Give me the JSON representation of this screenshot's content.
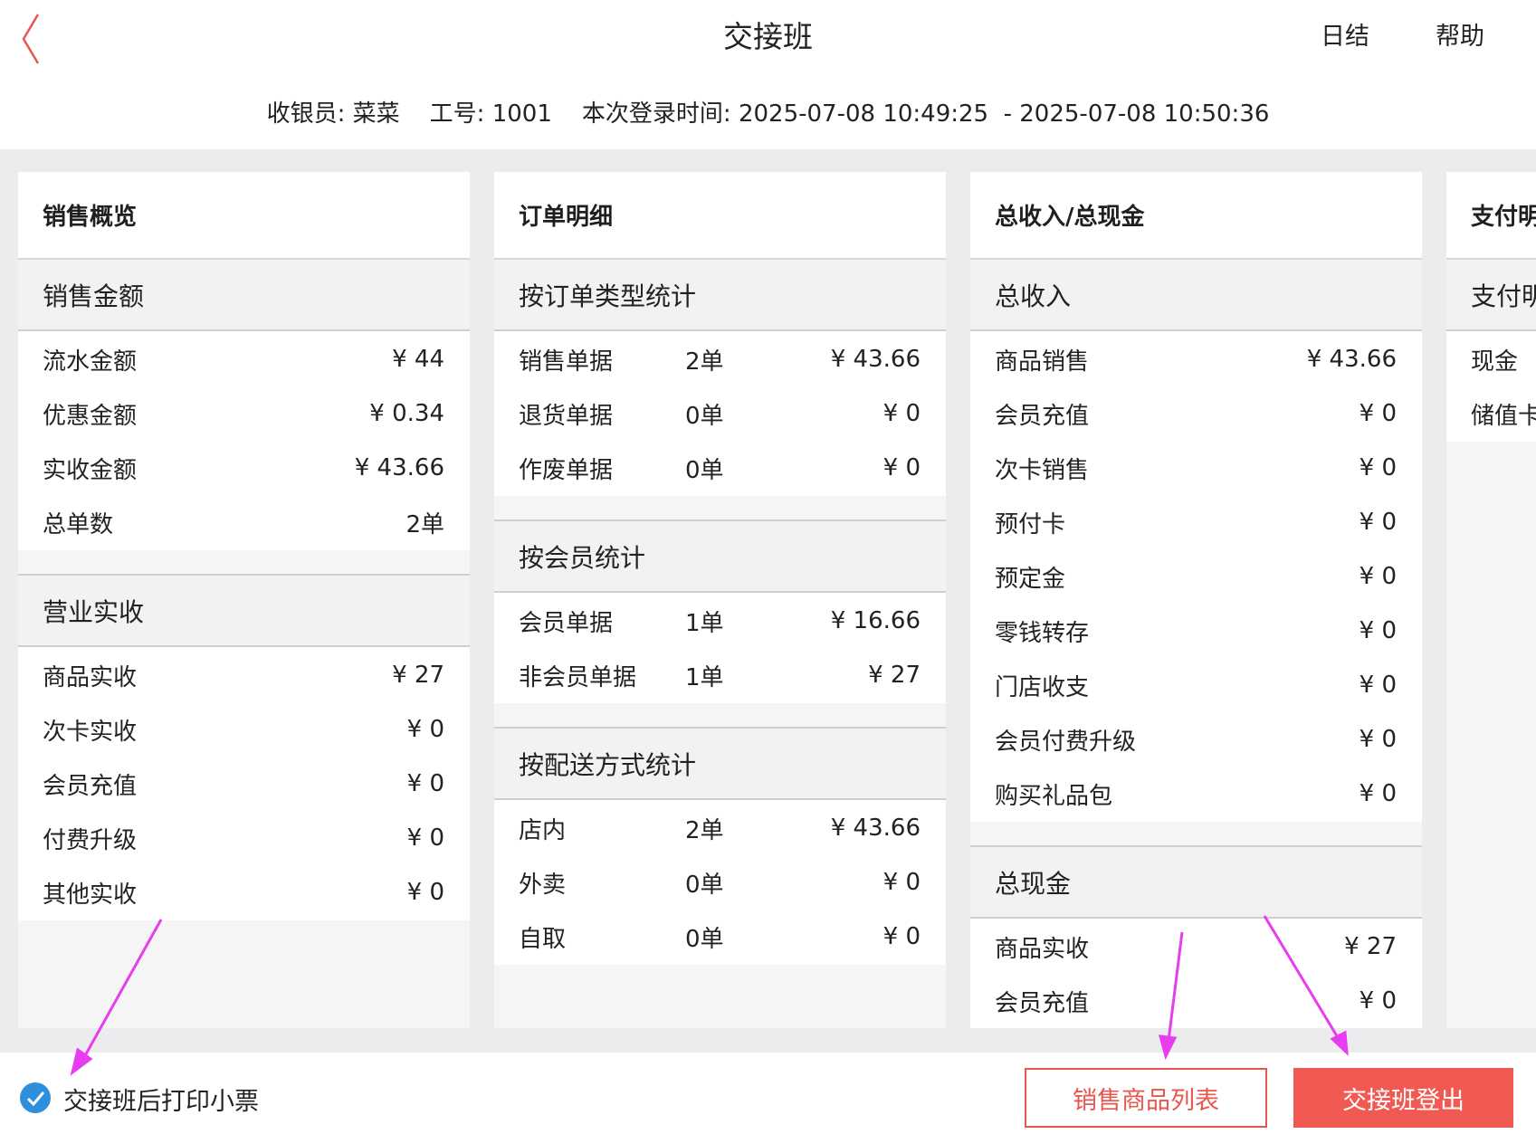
{
  "header": {
    "title": "交接班",
    "daily_close": "日结",
    "help": "帮助",
    "info_line": "收银员: 菜菜    工号: 1001    本次登录时间: 2025-07-08 10:49:25  - 2025-07-08 10:50:36"
  },
  "cards": [
    {
      "title": "销售概览",
      "sections": [
        {
          "title": "销售金额",
          "rows": [
            {
              "label": "流水金额",
              "count": "",
              "amount": "¥ 44"
            },
            {
              "label": "优惠金额",
              "count": "",
              "amount": "¥ 0.34"
            },
            {
              "label": "实收金额",
              "count": "",
              "amount": "¥ 43.66"
            },
            {
              "label": "总单数",
              "count": "",
              "amount": "2单"
            }
          ]
        },
        {
          "title": "营业实收",
          "rows": [
            {
              "label": "商品实收",
              "count": "",
              "amount": "¥ 27"
            },
            {
              "label": "次卡实收",
              "count": "",
              "amount": "¥ 0"
            },
            {
              "label": "会员充值",
              "count": "",
              "amount": "¥ 0"
            },
            {
              "label": "付费升级",
              "count": "",
              "amount": "¥ 0"
            },
            {
              "label": "其他实收",
              "count": "",
              "amount": "¥ 0"
            }
          ]
        }
      ]
    },
    {
      "title": "订单明细",
      "sections": [
        {
          "title": "按订单类型统计",
          "rows": [
            {
              "label": "销售单据",
              "count": "2单",
              "amount": "¥ 43.66"
            },
            {
              "label": "退货单据",
              "count": "0单",
              "amount": "¥ 0"
            },
            {
              "label": "作废单据",
              "count": "0单",
              "amount": "¥ 0"
            }
          ]
        },
        {
          "title": "按会员统计",
          "rows": [
            {
              "label": "会员单据",
              "count": "1单",
              "amount": "¥ 16.66"
            },
            {
              "label": "非会员单据",
              "count": "1单",
              "amount": "¥ 27"
            }
          ]
        },
        {
          "title": "按配送方式统计",
          "rows": [
            {
              "label": "店内",
              "count": "2单",
              "amount": "¥ 43.66"
            },
            {
              "label": "外卖",
              "count": "0单",
              "amount": "¥ 0"
            },
            {
              "label": "自取",
              "count": "0单",
              "amount": "¥ 0"
            }
          ]
        }
      ]
    },
    {
      "title": "总收入/总现金",
      "sections": [
        {
          "title": "总收入",
          "rows": [
            {
              "label": "商品销售",
              "count": "",
              "amount": "¥ 43.66"
            },
            {
              "label": "会员充值",
              "count": "",
              "amount": "¥ 0"
            },
            {
              "label": "次卡销售",
              "count": "",
              "amount": "¥ 0"
            },
            {
              "label": "预付卡",
              "count": "",
              "amount": "¥ 0"
            },
            {
              "label": "预定金",
              "count": "",
              "amount": "¥ 0"
            },
            {
              "label": "零钱转存",
              "count": "",
              "amount": "¥ 0"
            },
            {
              "label": "门店收支",
              "count": "",
              "amount": "¥ 0"
            },
            {
              "label": "会员付费升级",
              "count": "",
              "amount": "¥ 0"
            },
            {
              "label": "购买礼品包",
              "count": "",
              "amount": "¥ 0"
            }
          ]
        },
        {
          "title": "总现金",
          "rows": [
            {
              "label": "商品实收",
              "count": "",
              "amount": "¥ 27"
            },
            {
              "label": "会员充值",
              "count": "",
              "amount": "¥ 0"
            }
          ]
        }
      ]
    },
    {
      "title": "支付明",
      "sections": [
        {
          "title": "支付明",
          "rows": [
            {
              "label": "现金",
              "count": "",
              "amount": ""
            },
            {
              "label": "储值卡",
              "count": "",
              "amount": ""
            }
          ]
        }
      ]
    }
  ],
  "footer": {
    "print_receipt_checked": true,
    "print_receipt_label": "交接班后打印小票",
    "sales_list_button": "销售商品列表",
    "logout_button": "交接班登出"
  },
  "colors": {
    "accent": "#f15a52",
    "checkbox": "#2f8fdc",
    "annotation_arrow": "#e83cf0"
  }
}
